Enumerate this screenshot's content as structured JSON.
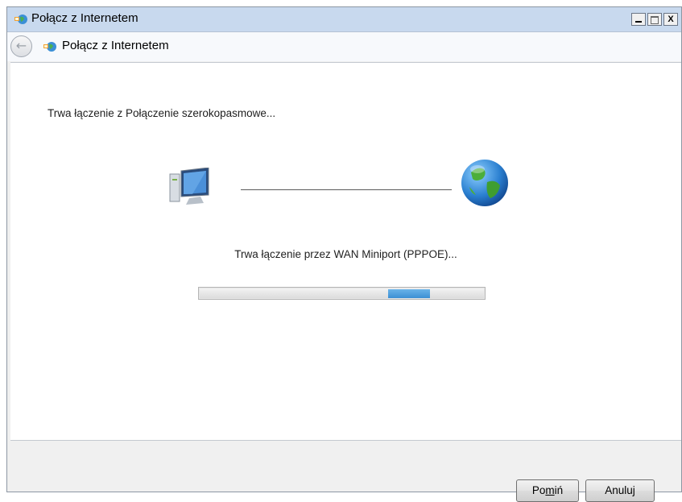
{
  "window": {
    "title": "Połącz z Internetem",
    "controls": {
      "minimize": "_",
      "close": "X"
    }
  },
  "nav": {
    "back_icon": "back-arrow-icon",
    "title": "Połącz z Internetem"
  },
  "main": {
    "heading": "Trwa łączenie z Połączenie szerokopasmowe...",
    "status": "Trwa łączenie przez WAN Miniport (PPPOE)...",
    "icons": {
      "computer": "computer-icon",
      "globe": "globe-icon"
    },
    "progress": {
      "mode": "marquee",
      "accent": "#3c8fd4",
      "position": 0.78
    }
  },
  "footer": {
    "skip_prefix": "Po",
    "skip_mnemonic": "m",
    "skip_suffix": "iń",
    "cancel": "Anuluj"
  },
  "colors": {
    "titlebar": "#c8d9ee",
    "progress_chunk": "#3c8fd4"
  }
}
